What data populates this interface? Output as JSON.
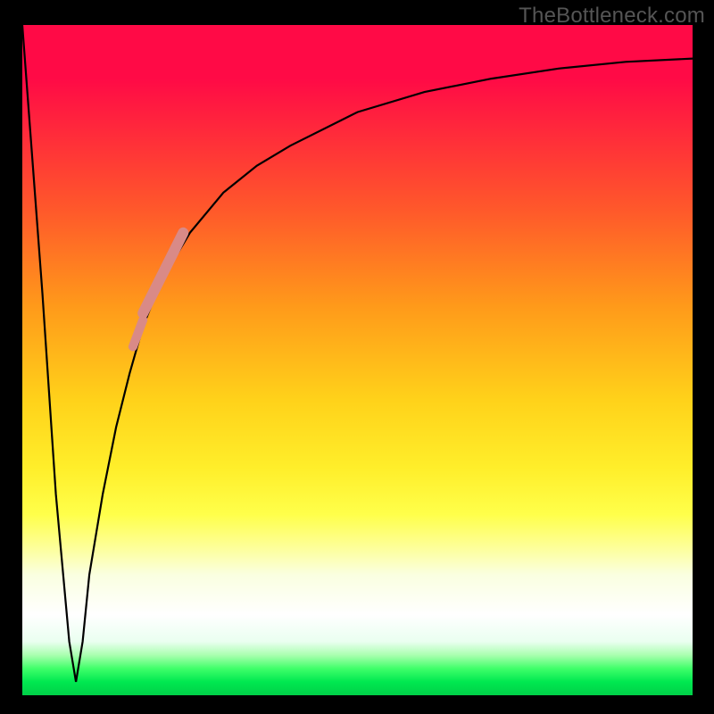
{
  "watermark": "TheBottleneck.com",
  "colors": {
    "frame": "#000000",
    "watermark_text": "#555555",
    "curve": "#000000",
    "highlight": "#d98a87",
    "gradient_top": "#ff0a46",
    "gradient_bottom": "#00d048"
  },
  "chart_data": {
    "type": "line",
    "title": "",
    "xlabel": "",
    "ylabel": "",
    "xlim": [
      0,
      100
    ],
    "ylim": [
      0,
      100
    ],
    "grid": false,
    "legend": false,
    "annotations": [],
    "series": [
      {
        "name": "bottleneck-curve",
        "x": [
          0,
          3,
          5,
          7,
          8,
          9,
          10,
          12,
          14,
          16,
          18,
          20,
          22,
          25,
          30,
          35,
          40,
          50,
          60,
          70,
          80,
          90,
          100
        ],
        "values": [
          100,
          60,
          30,
          8,
          2,
          8,
          18,
          30,
          40,
          48,
          55,
          60,
          64,
          69,
          75,
          79,
          82,
          87,
          90,
          92,
          93.5,
          94.5,
          95
        ]
      }
    ],
    "highlights": [
      {
        "name": "highlight-pill-large",
        "x_range": [
          18,
          24
        ],
        "y_range": [
          57,
          69
        ]
      },
      {
        "name": "highlight-pill-small",
        "x_range": [
          16.5,
          18
        ],
        "y_range": [
          52,
          56
        ]
      }
    ],
    "background_gradient": {
      "direction": "vertical",
      "stops": [
        {
          "pos": 0.0,
          "color": "#ff0a46"
        },
        {
          "pos": 0.28,
          "color": "#ff5a2a"
        },
        {
          "pos": 0.56,
          "color": "#ffd21a"
        },
        {
          "pos": 0.73,
          "color": "#ffff4a"
        },
        {
          "pos": 0.88,
          "color": "#ffffff"
        },
        {
          "pos": 0.96,
          "color": "#40ff6a"
        },
        {
          "pos": 1.0,
          "color": "#00d048"
        }
      ]
    }
  }
}
